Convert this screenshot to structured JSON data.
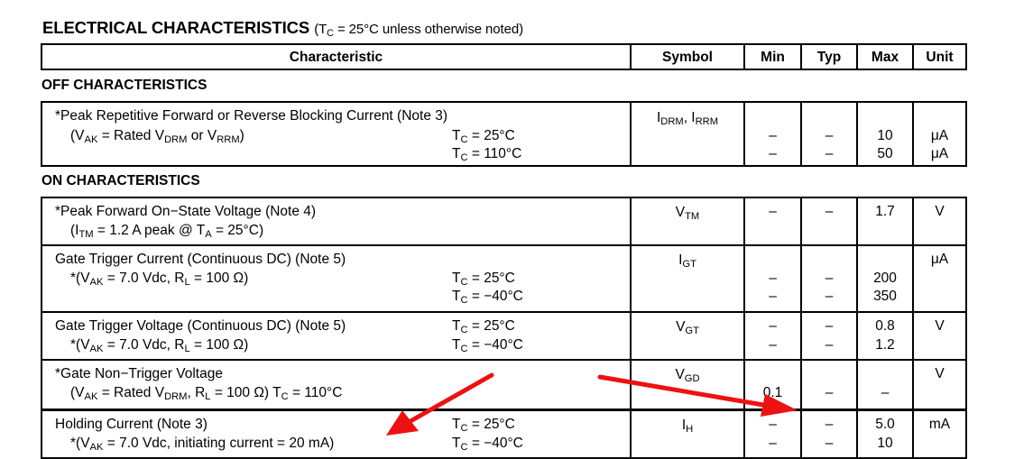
{
  "title": {
    "main": "ELECTRICAL CHARACTERISTICS",
    "cond_open": "(T",
    "cond_sub": "C",
    "cond_rest": " = 25°C unless otherwise noted)"
  },
  "columns": [
    "Characteristic",
    "Symbol",
    "Min",
    "Typ",
    "Max",
    "Unit"
  ],
  "sections": {
    "off": "OFF CHARACTERISTICS",
    "on": "ON CHARACTERISTICS"
  },
  "rows": {
    "idrm": {
      "line1": "*Peak Repetitive Forward or Reverse Blocking Current (Note 3)",
      "line2": {
        "a": "(V",
        "b": "AK",
        "c": " = Rated V",
        "d": "DRM",
        "e": " or V",
        "f": "RRM",
        "g": ")"
      },
      "cond1": {
        "a": "T",
        "b": "C",
        "c": " = 25°C"
      },
      "cond2": {
        "a": "T",
        "b": "C",
        "c": " = 110°C"
      },
      "symbol": {
        "a": "I",
        "b": "DRM",
        "c": ", I",
        "d": "RRM"
      },
      "min": [
        "–",
        "–"
      ],
      "typ": [
        "–",
        "–"
      ],
      "max": [
        "10",
        "50"
      ],
      "unit": [
        "μA",
        "μA"
      ]
    },
    "vtm": {
      "line1": "*Peak Forward On−State Voltage (Note 4)",
      "line2": {
        "a": "(I",
        "b": "TM",
        "c": " = 1.2 A peak @ T",
        "d": "A",
        "e": " = 25°C)"
      },
      "symbol": {
        "a": "V",
        "b": "TM"
      },
      "min": "–",
      "typ": "–",
      "max": "1.7",
      "unit": "V"
    },
    "igt": {
      "line1": "Gate Trigger Current (Continuous DC) (Note 5)",
      "line2": {
        "a": "*(V",
        "b": "AK",
        "c": " = 7.0 Vdc, R",
        "d": "L",
        "e": " = 100 Ω)"
      },
      "cond1": {
        "a": "T",
        "b": "C",
        "c": " = 25°C"
      },
      "cond2": {
        "a": "T",
        "b": "C",
        "c": " = −40°C"
      },
      "symbol": {
        "a": "I",
        "b": "GT"
      },
      "min": [
        "–",
        "–"
      ],
      "typ": [
        "–",
        "–"
      ],
      "max": [
        "200",
        "350"
      ],
      "unit": "μA"
    },
    "vgt": {
      "line1": "Gate Trigger Voltage (Continuous DC) (Note 5)",
      "line2": {
        "a": "*(V",
        "b": "AK",
        "c": " = 7.0 Vdc, R",
        "d": "L",
        "e": " = 100 Ω)"
      },
      "cond1": {
        "a": "T",
        "b": "C",
        "c": " = 25°C"
      },
      "cond2": {
        "a": "T",
        "b": "C",
        "c": " = −40°C"
      },
      "symbol": {
        "a": "V",
        "b": "GT"
      },
      "min": [
        "–",
        "–"
      ],
      "typ": [
        "–",
        "–"
      ],
      "max": [
        "0.8",
        "1.2"
      ],
      "unit": "V"
    },
    "vgd": {
      "line1": "*Gate Non−Trigger Voltage",
      "line2": {
        "a": "(V",
        "b": "AK",
        "c": " = Rated V",
        "d": "DRM",
        "e": ", R",
        "f": "L",
        "g": " = 100 Ω) T",
        "h": "C",
        "i": " = 110°C"
      },
      "symbol": {
        "a": "V",
        "b": "GD"
      },
      "min": "0.1",
      "typ": "–",
      "max": "–",
      "unit": "V"
    },
    "ih": {
      "line1": "Holding Current (Note 3)",
      "line2": {
        "a": "*(V",
        "b": "AK",
        "c": " = 7.0 Vdc, initiating current = 20 mA)"
      },
      "cond1": {
        "a": "T",
        "b": "C",
        "c": " = 25°C"
      },
      "cond2": {
        "a": "T",
        "b": "C",
        "c": " = −40°C"
      },
      "symbol": {
        "a": "I",
        "b": "H"
      },
      "min": [
        "–",
        "–"
      ],
      "typ": [
        "–",
        "–"
      ],
      "max": [
        "5.0",
        "10"
      ],
      "unit": "mA"
    }
  },
  "annotations": {
    "arrow_color": "#ee1111"
  }
}
